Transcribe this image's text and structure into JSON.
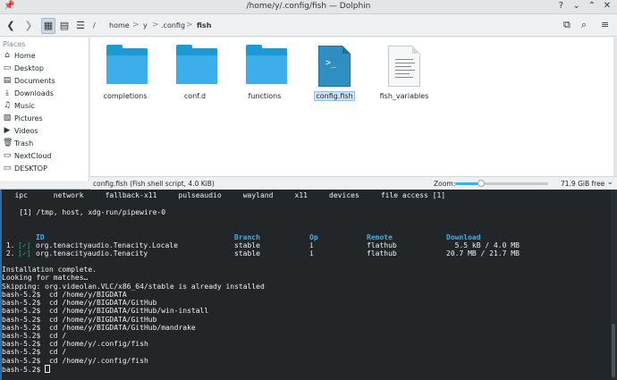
{
  "window": {
    "title": "/home/y/.config/fish — Dolphin",
    "pin_glyph": "📌",
    "help_glyph": "?",
    "min_glyph": "⌄",
    "max_glyph": "⌃",
    "close_glyph": "✕"
  },
  "toolbar": {
    "back_glyph": "❮",
    "forward_glyph": "❯",
    "icons_view_glyph": "▦",
    "compact_view_glyph": "▤",
    "details_view_glyph": "☰",
    "split_glyph": "⧉",
    "search_glyph": "⌕",
    "menu_glyph": "≡",
    "breadcrumb": [
      "/",
      "home",
      "y",
      ".config",
      "fish"
    ],
    "separator": ">"
  },
  "sidebar": {
    "header": "Places",
    "items": [
      {
        "label": "Home",
        "icon": "⌂"
      },
      {
        "label": "Desktop",
        "icon": "▭"
      },
      {
        "label": "Documents",
        "icon": "▤"
      },
      {
        "label": "Downloads",
        "icon": "⤓"
      },
      {
        "label": "Music",
        "icon": "♫"
      },
      {
        "label": "Pictures",
        "icon": "▧"
      },
      {
        "label": "Videos",
        "icon": "▶"
      },
      {
        "label": "Trash",
        "icon": "🗑"
      },
      {
        "label": "NextCloud",
        "icon": "▭"
      },
      {
        "label": "DESKTOP",
        "icon": "▭"
      }
    ]
  },
  "files": [
    {
      "name": "completions",
      "kind": "folder"
    },
    {
      "name": "conf.d",
      "kind": "folder"
    },
    {
      "name": "functions",
      "kind": "folder"
    },
    {
      "name": "config.fish",
      "kind": "script",
      "selected": true,
      "glyph": ">_"
    },
    {
      "name": "fish_variables",
      "kind": "text"
    }
  ],
  "status": {
    "selection": "config.fish (Fish shell script, 4.0 KiB)",
    "zoom_label": "Zoom:",
    "zoom_level": 0.28,
    "free_space": "71.9 GiB free",
    "menu_glyph": "⌄"
  },
  "terminal": {
    "top_line": "   ipc      network     fallback-x11     pulseaudio     wayland     x11     devices     file access [1]",
    "perm_line": "    [1] /tmp, host, xdg-run/pipewire-0",
    "table": {
      "headers": [
        "ID",
        "Branch",
        "Op",
        "Remote",
        "Download"
      ],
      "rows": [
        {
          "num": " 1.",
          "check": "[✓]",
          "id": "org.tenacityaudio.Tenacity.Locale",
          "branch": "stable",
          "op": "i",
          "remote": "flathub",
          "download": "  5.5 kB / 4.0 MB"
        },
        {
          "num": " 2.",
          "check": "[✓]",
          "id": "org.tenacityaudio.Tenacity",
          "branch": "stable",
          "op": "i",
          "remote": "flathub",
          "download": "20.7 MB / 21.7 MB"
        }
      ]
    },
    "log": [
      "Installation complete.",
      "Looking for matches…",
      "Skipping: org.videolan.VLC/x86_64/stable is already installed",
      "bash-5.2$  cd /home/y/BIGDATA",
      "bash-5.2$  cd /home/y/BIGDATA/GitHub",
      "bash-5.2$  cd /home/y/BIGDATA/GitHub/win-install",
      "bash-5.2$  cd /home/y/BIGDATA/GitHub",
      "bash-5.2$  cd /home/y/BIGDATA/GitHub/mandrake",
      "bash-5.2$  cd /",
      "bash-5.2$  cd /home/y/.config/fish",
      "bash-5.2$  cd /",
      "bash-5.2$  cd /home/y/.config/fish"
    ],
    "prompt": "bash-5.2$ "
  }
}
